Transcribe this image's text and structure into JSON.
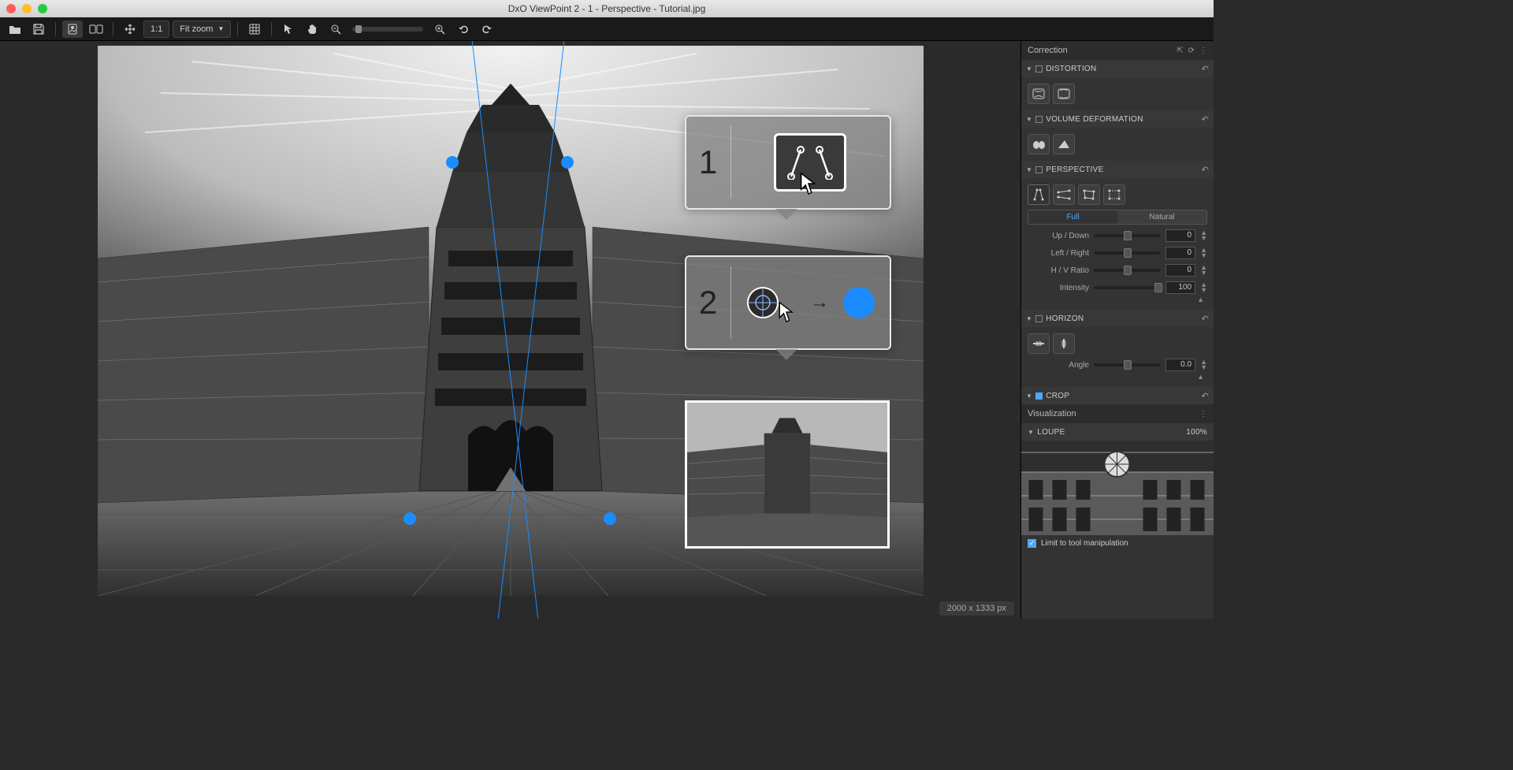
{
  "window": {
    "title": "DxO ViewPoint 2 - 1 - Perspective - Tutorial.jpg"
  },
  "toolbar": {
    "zoom_1_1": "1:1",
    "zoom_mode": "Fit zoom"
  },
  "canvas": {
    "dimensions": "2000 x 1333 px"
  },
  "hints": {
    "step1": "1",
    "step2": "2"
  },
  "sidebar": {
    "correction_title": "Correction",
    "distortion": {
      "title": "DISTORTION"
    },
    "volume": {
      "title": "VOLUME DEFORMATION"
    },
    "perspective": {
      "title": "PERSPECTIVE",
      "seg_full": "Full",
      "seg_natural": "Natural",
      "updown": {
        "label": "Up / Down",
        "value": "0"
      },
      "leftright": {
        "label": "Left / Right",
        "value": "0"
      },
      "hvratio": {
        "label": "H / V Ratio",
        "value": "0"
      },
      "intensity": {
        "label": "Intensity",
        "value": "100"
      }
    },
    "horizon": {
      "title": "HORIZON",
      "angle": {
        "label": "Angle",
        "value": "0.0"
      }
    },
    "crop": {
      "title": "CROP"
    },
    "visualization_title": "Visualization",
    "loupe": {
      "title": "LOUPE",
      "zoom": "100%"
    },
    "limit_checkbox": "Limit to tool manipulation"
  }
}
